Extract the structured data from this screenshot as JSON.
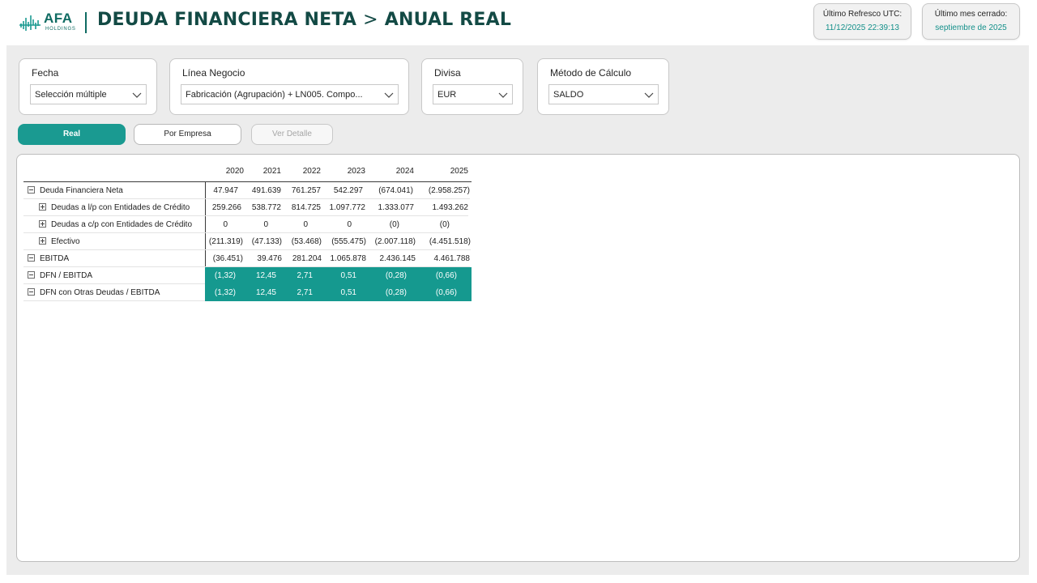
{
  "header": {
    "logo_main": "AFA",
    "logo_sub": "HOLDINGS",
    "title_part1": "DEUDA FINANCIERA NETA",
    "title_chevron": ">",
    "title_part2": "ANUAL REAL",
    "refresh_label": "Último Refresco UTC:",
    "refresh_value": "11/12/2025 22:39:13",
    "closed_label": "Último mes cerrado:",
    "closed_value": "septiembre de 2025"
  },
  "slicers": [
    {
      "label": "Fecha",
      "value": "Selección múltiple"
    },
    {
      "label": "Línea Negocio",
      "value": "Fabricación (Agrupación) + LN005. Compo..."
    },
    {
      "label": "Divisa",
      "value": "EUR"
    },
    {
      "label": "Método de Cálculo",
      "value": "SALDO"
    }
  ],
  "buttons": {
    "real": "Real",
    "por_empresa": "Por Empresa",
    "ver_detalle": "Ver Detalle"
  },
  "matrix": {
    "columns": [
      "2020",
      "2021",
      "2022",
      "2023",
      "2024",
      "2025"
    ],
    "rows": [
      {
        "label": "Deuda Financiera Neta",
        "values": [
          "47.947",
          "491.639",
          "761.257",
          "542.297",
          "(674.041)",
          "(2.958.257)"
        ]
      },
      {
        "label": "Deudas a l/p con Entidades de Crédito",
        "values": [
          "259.266",
          "538.772",
          "814.725",
          "1.097.772",
          "1.333.077",
          "1.493.262"
        ]
      },
      {
        "label": "Deudas a c/p con Entidades de Crédito",
        "values": [
          "0",
          "0",
          "0",
          "0",
          "(0)",
          "(0)"
        ]
      },
      {
        "label": "Efectivo",
        "values": [
          "(211.319)",
          "(47.133)",
          "(53.468)",
          "(555.475)",
          "(2.007.118)",
          "(4.451.518)"
        ]
      },
      {
        "label": "EBITDA",
        "values": [
          "(36.451)",
          "39.476",
          "281.204",
          "1.065.878",
          "2.436.145",
          "4.461.788"
        ]
      },
      {
        "label": "DFN / EBITDA",
        "values": [
          "(1,32)",
          "12,45",
          "2,71",
          "0,51",
          "(0,28)",
          "(0,66)"
        ]
      },
      {
        "label": "DFN con Otras Deudas / EBITDA",
        "values": [
          "(1,32)",
          "12,45",
          "2,71",
          "0,51",
          "(0,28)",
          "(0,66)"
        ]
      }
    ]
  },
  "colors": {
    "accent": "#1a9a91",
    "title": "#134a45",
    "highlight_row": "#15998f"
  }
}
